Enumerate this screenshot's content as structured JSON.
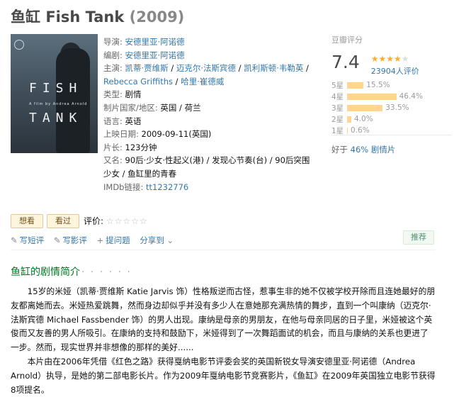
{
  "header": {
    "title_cn": "鱼缸",
    "title_en": "Fish Tank",
    "year": "(2009)"
  },
  "poster": {
    "line1": "FISH",
    "line2": "A film by Andrea Arnold",
    "line3": "TANK"
  },
  "info": {
    "director_label": "导演:",
    "director": "安德里亚·阿诺德",
    "writer_label": "编剧:",
    "writer": "安德里亚·阿诺德",
    "cast_label": "主演:",
    "cast": [
      "凯蒂·贾维斯",
      "迈克尔·法斯宾德",
      "凯利斯顿·韦勒英",
      "Rebecca Griffiths",
      "哈里·崔德威"
    ],
    "sep": " / ",
    "genre_label": "类型:",
    "genre": "剧情",
    "country_label": "制片国家/地区:",
    "country": "英国 / 荷兰",
    "language_label": "语言:",
    "language": "英语",
    "release_label": "上映日期:",
    "release": "2009-09-11(英国)",
    "runtime_label": "片长:",
    "runtime": "123分钟",
    "aka_label": "又名:",
    "aka": "90后·少女·性起义(港) / 发现心节奏(台) / 90后突围少女 / 鱼缸里的青春",
    "imdb_label": "IMDb链接:",
    "imdb": "tt1232776"
  },
  "rating": {
    "label": "豆瓣评分",
    "score": "7.4",
    "stars_filled": "★★★★",
    "stars_half": "★",
    "votes": "23904人评价",
    "distribution": [
      {
        "label": "5星",
        "percent": "15.5%",
        "value": 15.5
      },
      {
        "label": "4星",
        "percent": "46.4%",
        "value": 46.4
      },
      {
        "label": "3星",
        "percent": "33.5%",
        "value": 33.5
      },
      {
        "label": "2星",
        "percent": "4.0%",
        "value": 4.0
      },
      {
        "label": "1星",
        "percent": "0.6%",
        "value": 0.6
      }
    ],
    "better_prefix": "好于 ",
    "better_link": "46% 剧情片"
  },
  "controls": {
    "want": "想看",
    "watched": "看过",
    "rate_label": "评价:",
    "rate_stars": "☆☆☆☆☆",
    "short_review": "写短评",
    "long_review": "写影评",
    "ask": "提问题",
    "share": "分享到",
    "recommend": "推荐",
    "icon_pencil": "✎",
    "icon_plus": "+",
    "icon_chevron": "⌄"
  },
  "intro": {
    "title": "鱼缸的剧情简介",
    "dots": "· · · · · ·",
    "p1": "15岁的米娅（凯蒂·贾维斯 Katie Jarvis 饰）性格叛逆而古怪，惹事生非的她不仅被学校开除而且连她最好的朋友都离她而去。米娅热爱跳舞，然而身边却似乎并没有多少人在意她那充满热情的舞步，直到一个叫康纳（迈克尔·法斯宾德 Michael Fassbender 饰）的男人出现。康纳是母亲的男朋友，在他与母亲同居的日子里，米娅被这个英俊而又友善的男人所吸引。在康纳的支持和鼓励下，米娅得到了一次舞蹈面试的机会，而且与康纳的关系也更进了一步。然而，现实世界并非想像的那样的美好......",
    "p2": "本片由在2006年凭借《红色之路》获得戛纳电影节评委会奖的英国新锐女导演安德里亚·阿诺德（Andrea Arnold）执导，是她的第二部电影长片。作为2009年戛纳电影节竞赛影片，《鱼缸》在2009年英国独立电影节获得8项提名。"
  },
  "colors": {
    "link": "#3377aa",
    "green": "#007722",
    "star": "#ffac2d",
    "bar": "#ffd596"
  }
}
